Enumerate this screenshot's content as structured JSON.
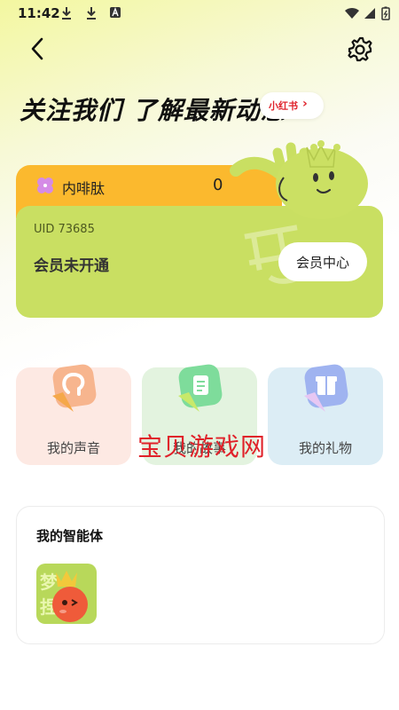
{
  "status_bar": {
    "time": "11:42",
    "icons": [
      "download-icon",
      "download-icon",
      "a-icon",
      "wifi-icon",
      "signal-icon",
      "battery-icon"
    ]
  },
  "header": {
    "back_icon": "chevron-left-icon",
    "settings_icon": "gear-icon"
  },
  "banner": {
    "title": "关注我们 了解最新动态",
    "xhs_label": "小红书",
    "xhs_arrow": "›"
  },
  "membership": {
    "token_name": "内啡肽",
    "token_value": "0",
    "uid": "UID 73685",
    "status": "会员未开通",
    "center_button": "会员中心",
    "colors": {
      "top": "#fbb92e",
      "main": "#c9df62"
    }
  },
  "features": [
    {
      "label": "我的声音",
      "icon": "voice-icon",
      "bg": "#fde9e3"
    },
    {
      "label": "我的故事",
      "icon": "document-icon",
      "bg": "#e3f3df"
    },
    {
      "label": "我的礼物",
      "icon": "gift-icon",
      "bg": "#dcedf5"
    }
  ],
  "watermark": "宝贝游戏网",
  "agents": {
    "title": "我的智能体",
    "avatar_text": "梦\n捏"
  }
}
